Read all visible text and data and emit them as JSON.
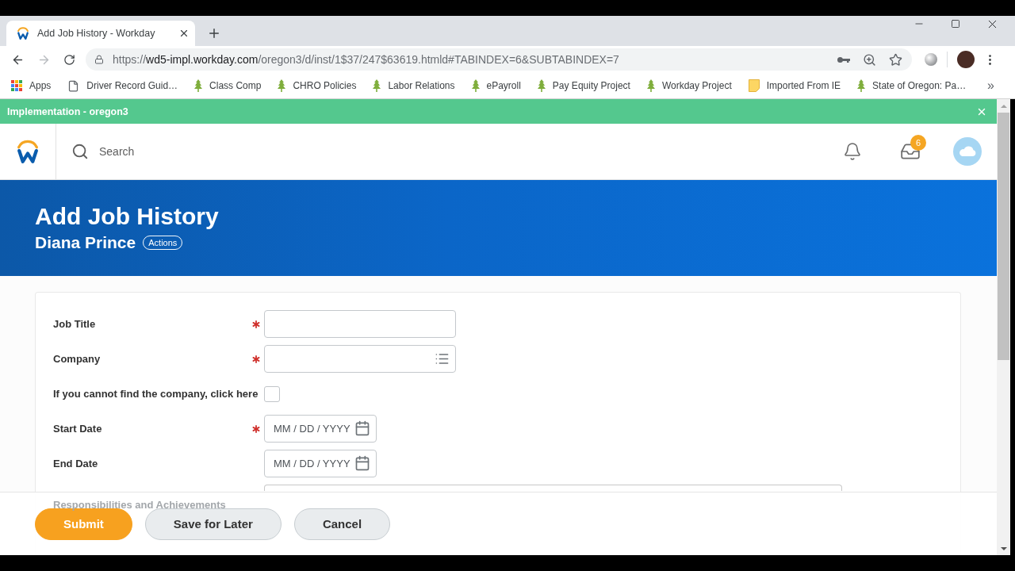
{
  "browser": {
    "tabs": [
      {
        "title": "Add Job History - Workday",
        "selected": true
      }
    ],
    "address_bar": {
      "scheme": "https://",
      "host": "wd5-impl.workday.com",
      "path": "/oregon3/d/inst/1$37/247$63619.htmld#TABINDEX=6&SUBTABINDEX=7"
    },
    "bookmarks": [
      {
        "label": "Apps",
        "kind": "apps"
      },
      {
        "label": "Driver Record Guid…",
        "kind": "page"
      },
      {
        "label": "Class Comp",
        "kind": "tree"
      },
      {
        "label": "CHRO Policies",
        "kind": "tree"
      },
      {
        "label": "Labor Relations",
        "kind": "tree"
      },
      {
        "label": "ePayroll",
        "kind": "tree"
      },
      {
        "label": "Pay Equity Project",
        "kind": "tree"
      },
      {
        "label": "Workday Project",
        "kind": "tree"
      },
      {
        "label": "Imported From IE",
        "kind": "folder"
      },
      {
        "label": "State of Oregon: Pa…",
        "kind": "tree"
      }
    ],
    "bookmarks_overflow": "»"
  },
  "environment_banner": {
    "text": "Implementation - oregon3"
  },
  "header": {
    "search": {
      "placeholder": "Search"
    },
    "inbox_badge": "6"
  },
  "page_header": {
    "title": "Add Job History",
    "worker": "Diana Prince",
    "actions_label": "Actions"
  },
  "form": {
    "fields": [
      {
        "label": "Job Title",
        "kind": "text",
        "required": true
      },
      {
        "label": "Company",
        "kind": "prompt",
        "required": true
      },
      {
        "label": "If you cannot find the company, click here",
        "kind": "checkbox",
        "required": false,
        "checked": false
      },
      {
        "label": "Start Date",
        "kind": "date",
        "required": true,
        "placeholder": "MM / DD / YYYY"
      },
      {
        "label": "End Date",
        "kind": "date",
        "required": false,
        "placeholder": "MM / DD / YYYY"
      },
      {
        "label": "Responsibilities and Achievements",
        "kind": "textarea",
        "required": false
      }
    ]
  },
  "footer": {
    "buttons": [
      {
        "label": "Submit",
        "kind": "primary"
      },
      {
        "label": "Save for Later",
        "kind": "secondary"
      },
      {
        "label": "Cancel",
        "kind": "secondary"
      }
    ]
  }
}
